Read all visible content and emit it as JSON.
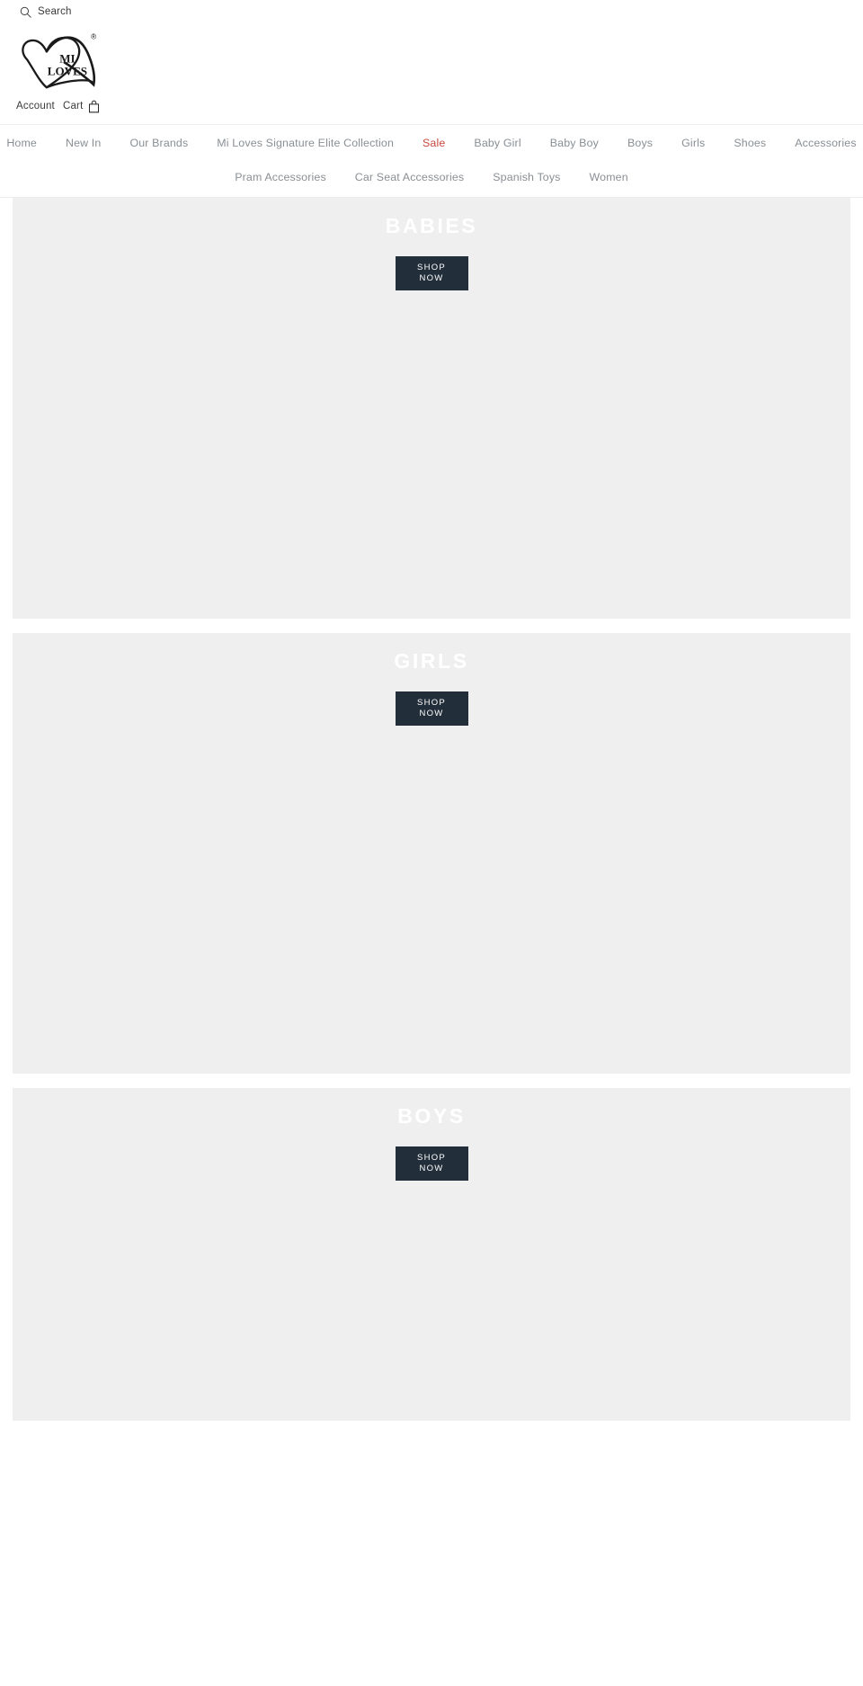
{
  "utility": {
    "search_label": "Search",
    "search_icon": "search-icon"
  },
  "logo": {
    "line1": "MI",
    "line2": "LOVES",
    "registered_mark": "®",
    "alt": "Mi Loves"
  },
  "account": {
    "account_label": "Account",
    "cart_label": "Cart",
    "cart_icon": "shopping-bag-icon"
  },
  "nav": {
    "row1": [
      {
        "label": "Home",
        "highlight": false
      },
      {
        "label": "New In",
        "highlight": false
      },
      {
        "label": "Our Brands",
        "highlight": false
      },
      {
        "label": "Mi Loves Signature Elite Collection",
        "highlight": false
      },
      {
        "label": "Sale",
        "highlight": true
      },
      {
        "label": "Baby Girl",
        "highlight": false
      },
      {
        "label": "Baby Boy",
        "highlight": false
      },
      {
        "label": "Boys",
        "highlight": false
      },
      {
        "label": "Girls",
        "highlight": false
      },
      {
        "label": "Shoes",
        "highlight": false
      },
      {
        "label": "Accessories",
        "highlight": false
      }
    ],
    "row2": [
      {
        "label": "Pram Accessories"
      },
      {
        "label": "Car Seat Accessories"
      },
      {
        "label": "Spanish Toys"
      },
      {
        "label": "Women"
      }
    ]
  },
  "banners": [
    {
      "title": "BABIES",
      "cta_line1": "SHOP",
      "cta_line2": "NOW"
    },
    {
      "title": "GIRLS",
      "cta_line1": "SHOP",
      "cta_line2": "NOW"
    },
    {
      "title": "BOYS",
      "cta_line1": "SHOP",
      "cta_line2": "NOW"
    }
  ],
  "colors": {
    "sale_accent": "#c8493f",
    "button_bg": "#222e3a",
    "banner_bg": "#efefef",
    "nav_text": "#8a8f94"
  }
}
